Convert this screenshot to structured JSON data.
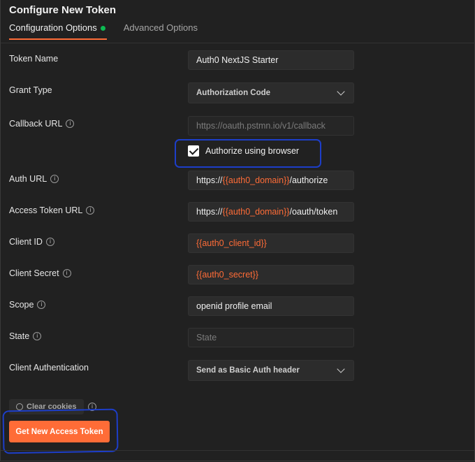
{
  "title": "Configure New Token",
  "tabs": [
    {
      "label": "Configuration Options",
      "active": true,
      "status_dot_color": "#0cbb52"
    },
    {
      "label": "Advanced Options",
      "active": false
    }
  ],
  "fields": {
    "token_name": {
      "label": "Token Name",
      "value": "Auth0 NextJS Starter"
    },
    "grant_type": {
      "label": "Grant Type",
      "value": "Authorization Code"
    },
    "callback_url": {
      "label": "Callback URL",
      "placeholder": "https://oauth.pstmn.io/v1/callback"
    },
    "authorize_browser": {
      "label": "Authorize using browser",
      "checked": true
    },
    "auth_url": {
      "label": "Auth URL",
      "prefix": "https://",
      "var": "{{auth0_domain}}",
      "suffix": "/authorize"
    },
    "access_token_url": {
      "label": "Access Token URL",
      "prefix": "https://",
      "var": "{{auth0_domain}}",
      "suffix": "/oauth/token"
    },
    "client_id": {
      "label": "Client ID",
      "var": "{{auth0_client_id}}"
    },
    "client_secret": {
      "label": "Client Secret",
      "var": "{{auth0_secret}}"
    },
    "scope": {
      "label": "Scope",
      "value": "openid profile email"
    },
    "state": {
      "label": "State",
      "placeholder": "State"
    },
    "client_auth": {
      "label": "Client Authentication",
      "value": "Send as Basic Auth header"
    }
  },
  "clear_cookies_label": "Clear cookies",
  "get_token_label": "Get New Access Token",
  "colors": {
    "accent": "#ff6c37",
    "annotation": "#1d3ec9",
    "background": "#212121"
  }
}
